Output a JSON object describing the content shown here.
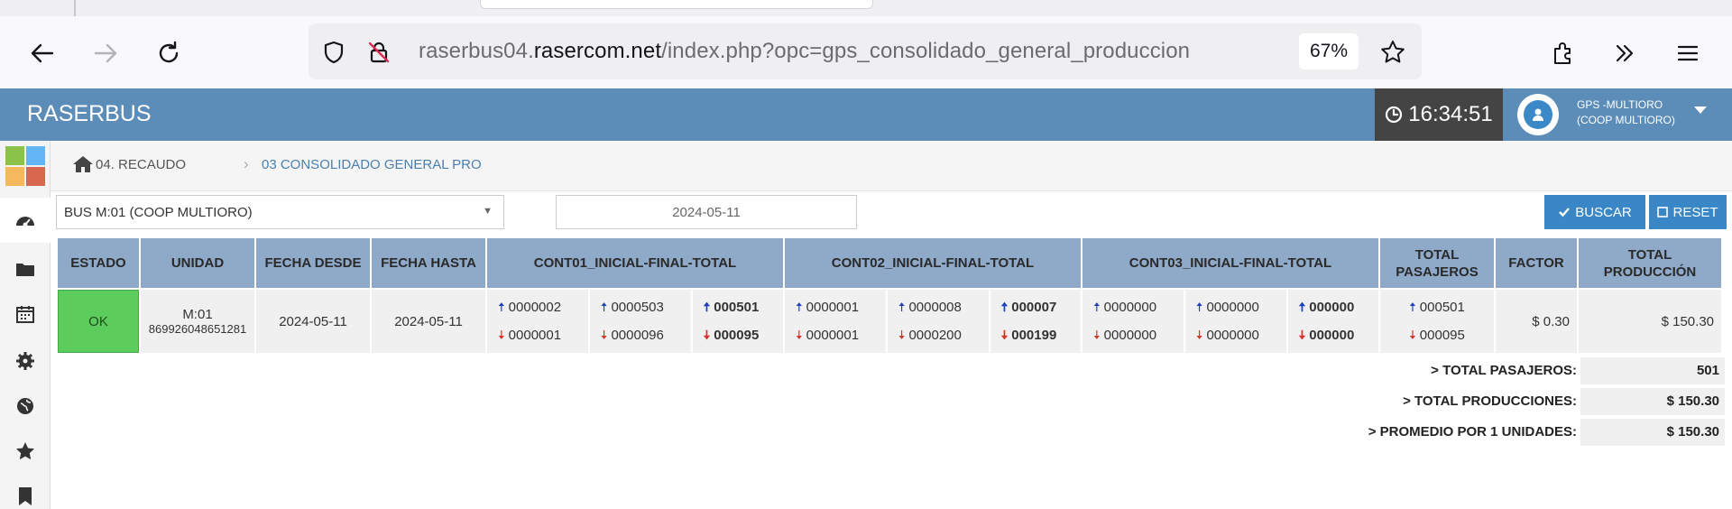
{
  "browser": {
    "url_prefix": "raserbus04.",
    "url_domain": "rasercom.net",
    "url_path": "/index.php?opc=gps_consolidado_general_produccion",
    "zoom": "67%"
  },
  "header": {
    "brand": "RASERBUS",
    "time": "16:34:51",
    "user_line1": "GPS -MULTIORO",
    "user_line2": "(COOP MULTIORO)"
  },
  "breadcrumb": {
    "section": "04. RECAUDO",
    "page": "03 CONSOLIDADO GENERAL PRO"
  },
  "filters": {
    "bus_selected": "BUS M:01 (COOP MULTIORO)",
    "date": "2024-05-11",
    "search_label": "BUSCAR",
    "reset_label": "RESET"
  },
  "table": {
    "headers": {
      "estado": "ESTADO",
      "unidad": "UNIDAD",
      "fecha_desde": "FECHA DESDE",
      "fecha_hasta": "FECHA HASTA",
      "cont01": "CONT01_INICIAL-FINAL-TOTAL",
      "cont02": "CONT02_INICIAL-FINAL-TOTAL",
      "cont03": "CONT03_INICIAL-FINAL-TOTAL",
      "total_pasajeros_1": "TOTAL",
      "total_pasajeros_2": "PASAJEROS",
      "factor": "FACTOR",
      "total_produccion_1": "TOTAL",
      "total_produccion_2": "PRODUCCIÓN"
    },
    "row": {
      "estado": "OK",
      "unidad": "M:01",
      "unidad_id": "869926048651281",
      "fecha_desde": "2024-05-11",
      "fecha_hasta": "2024-05-11",
      "cont01": {
        "inicial_up": "0000002",
        "inicial_down": "0000001",
        "final_up": "0000503",
        "final_down": "0000096",
        "total_up": "000501",
        "total_down": "000095"
      },
      "cont02": {
        "inicial_up": "0000001",
        "inicial_down": "0000001",
        "final_up": "0000008",
        "final_down": "0000200",
        "total_up": "000007",
        "total_down": "000199"
      },
      "cont03": {
        "inicial_up": "0000000",
        "inicial_down": "0000000",
        "final_up": "0000000",
        "final_down": "0000000",
        "total_up": "000000",
        "total_down": "000000"
      },
      "total_pasajeros_up": "000501",
      "total_pasajeros_down": "000095",
      "factor": "$ 0.30",
      "total_produccion": "$ 150.30"
    }
  },
  "summary": {
    "total_pasajeros_label": "> TOTAL PASAJEROS:",
    "total_pasajeros_value": "501",
    "total_producciones_label": "> TOTAL PRODUCCIONES:",
    "total_producciones_value": "$ 150.30",
    "promedio_label": "> PROMEDIO POR 1 UNIDADES:",
    "promedio_value": "$ 150.30"
  },
  "colors": {
    "appbar": "#5b8db8",
    "table_header": "#8fa9c8",
    "status_ok": "#5ccc5c",
    "button": "#3a87c7",
    "arrow_up": "#1f3fbf",
    "arrow_down": "#d9332b"
  },
  "icons": {
    "back": "arrow-left-icon",
    "forward": "arrow-right-icon",
    "reload": "reload-icon",
    "shield": "shield-icon",
    "insecure": "lock-slash-icon",
    "bookmark": "star-icon",
    "extensions": "puzzle-icon",
    "overflow": "chevron-double-right-icon",
    "menu": "hamburger-icon",
    "clock": "clock-icon",
    "user": "user-icon",
    "home": "home-icon",
    "check": "check-icon",
    "reset": "square-icon"
  }
}
